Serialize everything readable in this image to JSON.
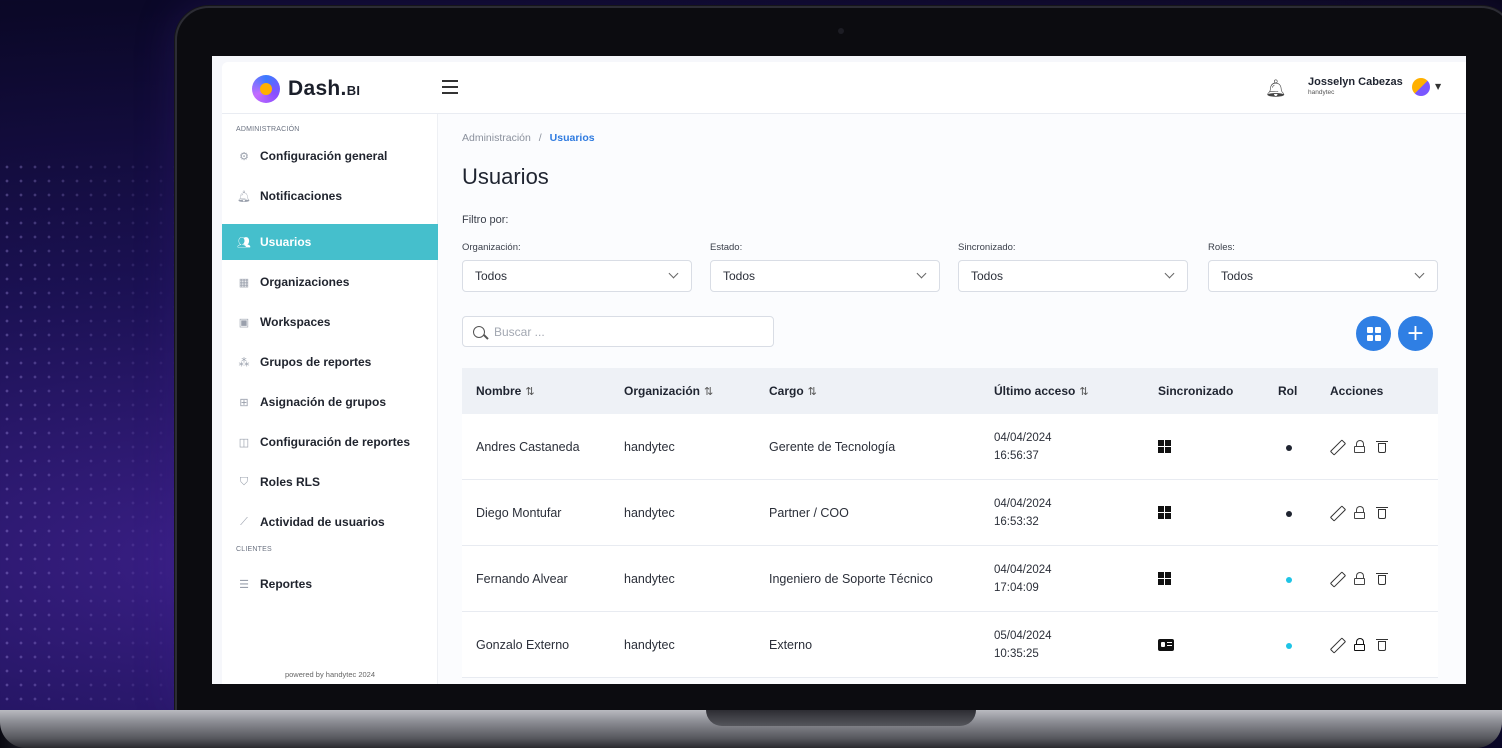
{
  "app": {
    "logo_text": "Dash.",
    "logo_suffix": "BI"
  },
  "header": {
    "user_name": "Josselyn Cabezas",
    "user_org": "handytec"
  },
  "sidebar": {
    "section_admin": "ADMINISTRACIÓN",
    "section_clients": "CLIENTES",
    "items": [
      {
        "label": "Configuración general",
        "icon": "gear-icon"
      },
      {
        "label": "Notificaciones",
        "icon": "bell-icon"
      },
      {
        "label": "Usuarios",
        "icon": "users-icon",
        "active": true
      },
      {
        "label": "Organizaciones",
        "icon": "building-icon"
      },
      {
        "label": "Workspaces",
        "icon": "workspace-icon"
      },
      {
        "label": "Grupos de reportes",
        "icon": "groups-icon"
      },
      {
        "label": "Asignación de grupos",
        "icon": "grid-icon"
      },
      {
        "label": "Configuración de reportes",
        "icon": "layout-icon"
      },
      {
        "label": "Roles RLS",
        "icon": "shield-icon"
      },
      {
        "label": "Actividad de usuarios",
        "icon": "chart-icon"
      }
    ],
    "client_items": [
      {
        "label": "Reportes",
        "icon": "report-icon"
      }
    ],
    "powered": "powered by handytec 2024"
  },
  "main": {
    "breadcrumb_parent": "Administración",
    "breadcrumb_sep": "/",
    "breadcrumb_current": "Usuarios",
    "title": "Usuarios",
    "filter_by": "Filtro por:",
    "filters": [
      {
        "label": "Organización:",
        "value": "Todos"
      },
      {
        "label": "Estado:",
        "value": "Todos"
      },
      {
        "label": "Sincronizado:",
        "value": "Todos"
      },
      {
        "label": "Roles:",
        "value": "Todos"
      }
    ],
    "search_placeholder": "Buscar ..."
  },
  "table": {
    "headers": {
      "name": "Nombre",
      "org": "Organización",
      "cargo": "Cargo",
      "access": "Último acceso",
      "sync": "Sincronizado",
      "rol": "Rol",
      "actions": "Acciones"
    },
    "sort_glyph": "⇅",
    "rows": [
      {
        "name": "Andres Castaneda",
        "org": "handytec",
        "cargo": "Gerente de Tecnología",
        "date": "04/04/2024",
        "time": "16:56:37",
        "sync": "windows-icon",
        "rol_color": "#1f2430"
      },
      {
        "name": "Diego Montufar",
        "org": "handytec",
        "cargo": "Partner / COO",
        "date": "04/04/2024",
        "time": "16:53:32",
        "sync": "windows-icon",
        "rol_color": "#1f2430"
      },
      {
        "name": "Fernando Alvear",
        "org": "handytec",
        "cargo": "Ingeniero de Soporte Técnico",
        "date": "04/04/2024",
        "time": "17:04:09",
        "sync": "windows-icon",
        "rol_color": "#1ec4e6"
      },
      {
        "name": "Gonzalo Externo",
        "org": "handytec",
        "cargo": "Externo",
        "date": "05/04/2024",
        "time": "10:35:25",
        "sync": "id-card-icon",
        "rol_color": "#1ec4e6"
      }
    ]
  },
  "colors": {
    "accent": "#45bfcc",
    "primary_button": "#2f7fe4",
    "link": "#2f7be0"
  }
}
